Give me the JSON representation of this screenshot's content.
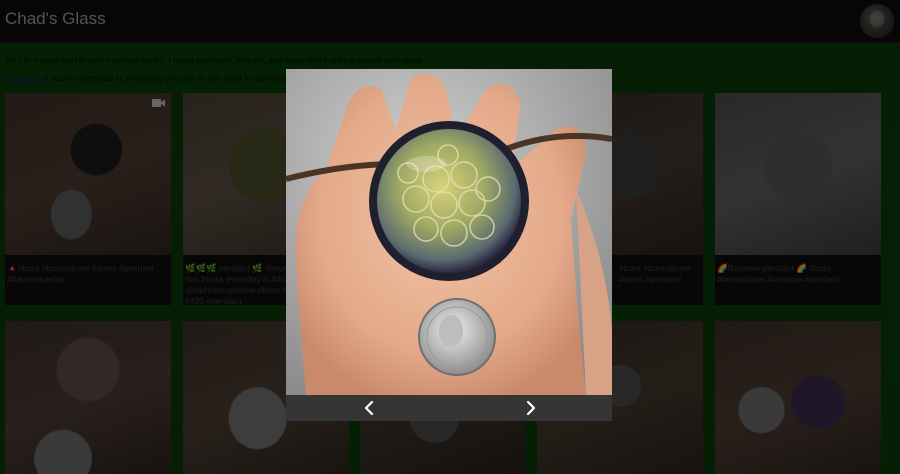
{
  "header": {
    "title": "Chad's Glass"
  },
  "intro": {
    "text": "Yo! I'm a lamp worker with a private studio. I make pendants, trinkets, and many more unique pieces with glass.",
    "link_label": "Hit me up",
    "link_rest": " if you're interested in something you see or you want to commission"
  },
  "posts": [
    {
      "caption": "🔺#boro #borosilicate #glass #pendant #haveaniceday",
      "has_video": true
    },
    {
      "caption": "🌿🌿🌿 pendant 🌿 shout out to someone that thinks everyday is 420!!! goes to @clphotocapstone #boro #borosilicate #420 #pendant",
      "has_video": false
    },
    {
      "caption": "",
      "has_video": false
    },
    {
      "caption": "#boro #borosilicate #glass #pendant",
      "has_video": false
    },
    {
      "caption": "🌈Rainbow pendant 🌈 #boro #borosilicate #rainbow #pendant",
      "has_video": false
    }
  ],
  "lightbox": {
    "prev_label": "‹",
    "next_label": "›"
  },
  "colors": {
    "page_green": "#0b8f0b",
    "header_bg": "#0d0a0e"
  }
}
